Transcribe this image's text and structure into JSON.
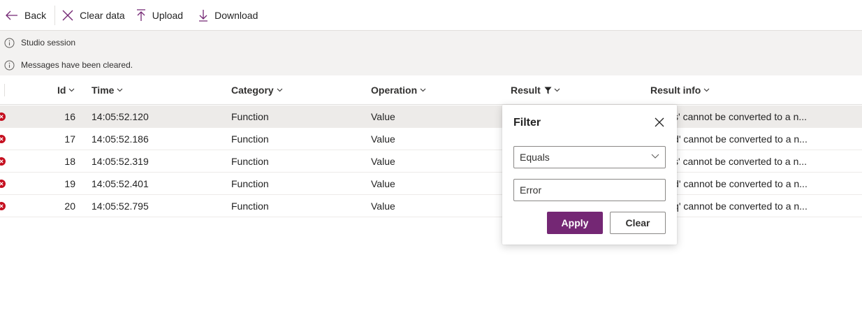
{
  "toolbar": {
    "back_label": "Back",
    "clear_label": "Clear data",
    "upload_label": "Upload",
    "download_label": "Download"
  },
  "messages": [
    {
      "text": "Studio session"
    },
    {
      "text": "Messages have been cleared."
    }
  ],
  "grid": {
    "columns": {
      "id": "Id",
      "time": "Time",
      "category": "Category",
      "operation": "Operation",
      "result": "Result",
      "result_info": "Result info"
    },
    "rows": [
      {
        "id": "16",
        "time": "14:05:52.120",
        "category": "Function",
        "operation": "Value",
        "info": "alue 's' cannot be converted to a n..."
      },
      {
        "id": "17",
        "time": "14:05:52.186",
        "category": "Function",
        "operation": "Value",
        "info": "alue 'd' cannot be converted to a n..."
      },
      {
        "id": "18",
        "time": "14:05:52.319",
        "category": "Function",
        "operation": "Value",
        "info": "alue 's' cannot be converted to a n..."
      },
      {
        "id": "19",
        "time": "14:05:52.401",
        "category": "Function",
        "operation": "Value",
        "info": "alue 'd' cannot be converted to a n..."
      },
      {
        "id": "20",
        "time": "14:05:52.795",
        "category": "Function",
        "operation": "Value",
        "info": "alue 'q' cannot be converted to a n..."
      }
    ]
  },
  "filter": {
    "title": "Filter",
    "operator_value": "Equals",
    "value": "Error",
    "apply_label": "Apply",
    "clear_label": "Clear"
  },
  "colors": {
    "accent": "#742774",
    "error": "#c50f1f",
    "selected_row": "#edebe9",
    "message_bar": "#f3f2f1"
  },
  "icons": {
    "back": "arrow-left-icon",
    "clear": "close-icon",
    "upload": "upload-icon",
    "download": "download-icon",
    "info": "info-icon",
    "error": "error-circle-icon",
    "filter": "funnel-icon",
    "chevron": "chevron-down-icon"
  }
}
